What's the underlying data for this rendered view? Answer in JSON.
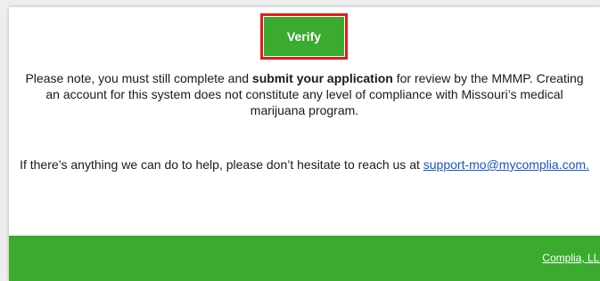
{
  "verify": {
    "label": "Verify"
  },
  "notice": {
    "before": "Please note, you must still complete and ",
    "bold": "submit your application",
    "after": " for review by the MMMP. Creating an account for this system does not constitute any level of compliance with Missouri’s medical marijuana program."
  },
  "help": {
    "text": "If there’s anything we can do to help, please don’t hesitate to reach us at ",
    "email_link": "support-mo@mycomplia.com."
  },
  "footer": {
    "company_link": "Complia, LLC"
  },
  "colors": {
    "brand_green": "#3aab2f",
    "highlight_red": "#e21b1b",
    "link_blue": "#1a55c7"
  }
}
